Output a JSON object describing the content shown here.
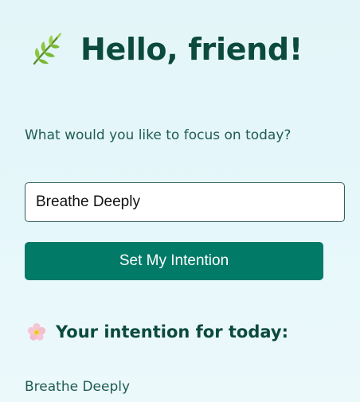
{
  "greeting": {
    "icon": "herb-leaf-icon",
    "title": "Hello, friend!"
  },
  "form": {
    "prompt": "What would you like to focus on today?",
    "input_value": "Breathe Deeply",
    "button_label": "Set My Intention"
  },
  "result": {
    "icon": "flower-icon",
    "heading": "Your intention for today:",
    "value": "Breathe Deeply"
  },
  "colors": {
    "accent": "#017a68",
    "heading_text": "#0b4a3d",
    "body_text": "#1f5c52",
    "background": "#e6f7fb"
  }
}
